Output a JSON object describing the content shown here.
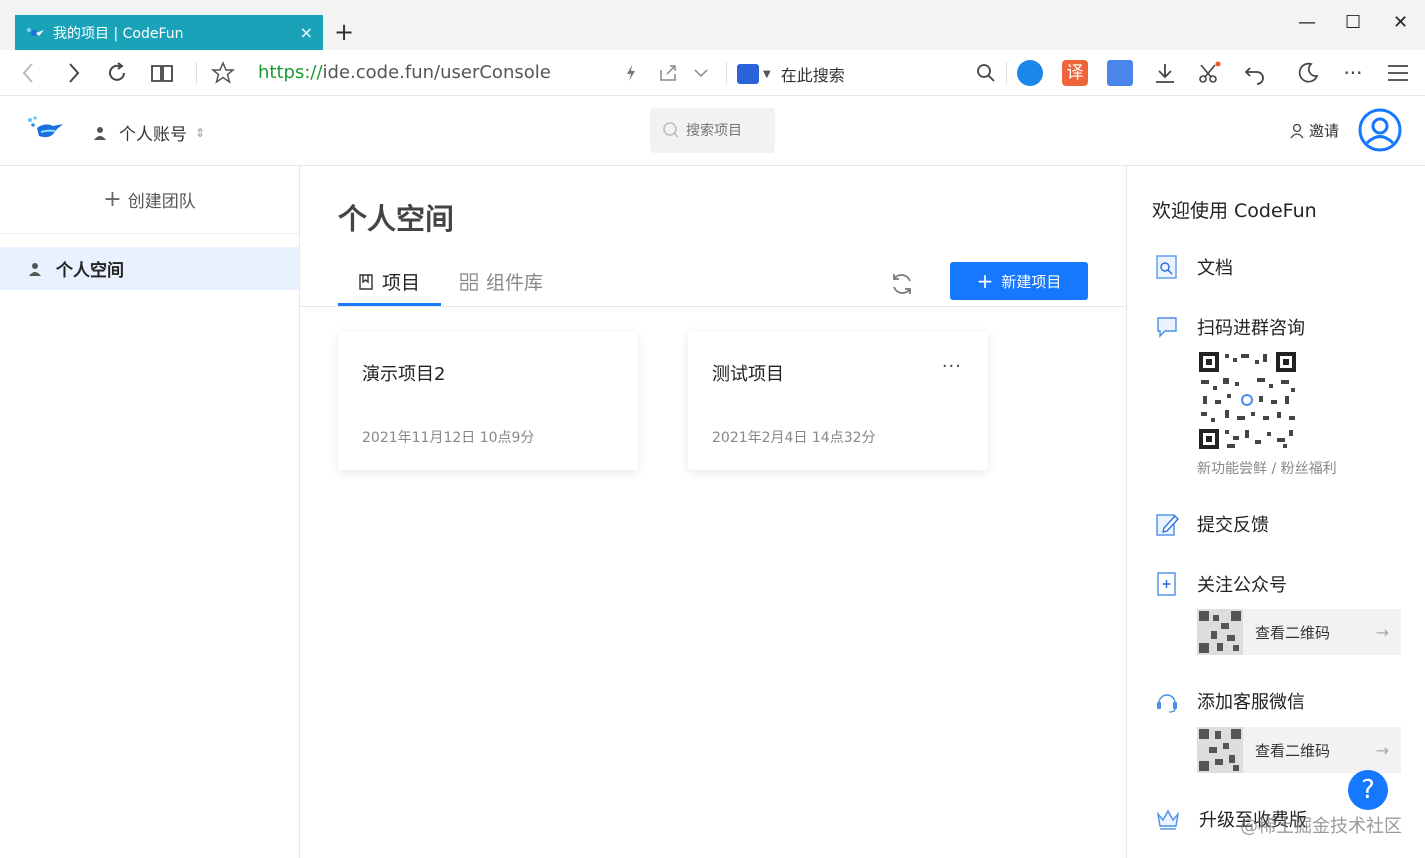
{
  "browser": {
    "tab_title": "我的项目 | CodeFun",
    "tab_close": "×",
    "new_tab": "+",
    "url_scheme": "https://",
    "url_rest": "ide.code.fun/userConsole",
    "search_engine_label": "在此搜索",
    "window_controls": {
      "minimize": "—",
      "maximize": "☐",
      "close": "✕"
    }
  },
  "header": {
    "account_label": "个人账号",
    "search_placeholder": "搜索项目",
    "invite_label": "邀请"
  },
  "sidebar": {
    "create_team_label": "创建团队",
    "items": [
      {
        "label": "个人空间",
        "icon": "user-icon",
        "active": true
      }
    ]
  },
  "main": {
    "title": "个人空间",
    "tabs": [
      {
        "label": "项目",
        "icon": "book-icon",
        "active": true
      },
      {
        "label": "组件库",
        "icon": "grid-icon",
        "active": false
      }
    ],
    "new_project_label": "新建项目",
    "projects": [
      {
        "name": "演示项目2",
        "date": "2021年11月12日 10点9分",
        "has_more": false
      },
      {
        "name": "测试项目",
        "date": "2021年2月4日 14点32分",
        "has_more": true
      }
    ],
    "more_label": "···"
  },
  "rpanel": {
    "welcome": "欢迎使用 CodeFun",
    "docs_label": "文档",
    "group_label": "扫码进群咨询",
    "group_note": "新功能尝鲜 / 粉丝福利",
    "feedback_label": "提交反馈",
    "follow_label": "关注公众号",
    "view_qr_label": "查看二维码",
    "service_label": "添加客服微信",
    "upgrade_label": "升级至收费版"
  },
  "watermark": "@稀土掘金技术社区",
  "help_label": "?",
  "colors": {
    "primary": "#1677ff",
    "tab_bg": "#1aa3b8",
    "active_side_bg": "#e8f1fd"
  }
}
